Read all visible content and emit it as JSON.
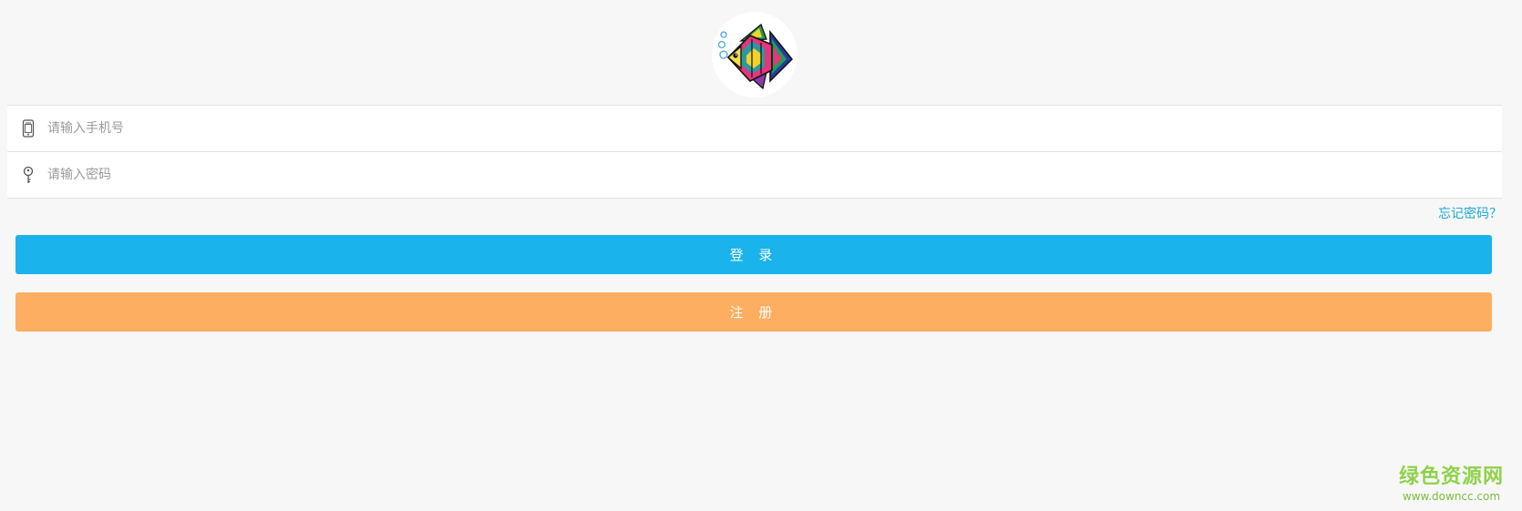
{
  "login_form": {
    "phone_placeholder": "请输入手机号",
    "password_placeholder": "请输入密码",
    "forgot_password": "忘记密码？",
    "login_button": "登 录",
    "register_button": "注 册"
  },
  "icons": {
    "avatar": "fish-illustration",
    "phone": "mobile-phone-icon",
    "password": "key-icon"
  },
  "colors": {
    "background": "#f7f7f7",
    "login_button": "#1ab3ec",
    "register_button": "#fdae60",
    "link": "#1ca8d8",
    "watermark": "#8fd24a"
  },
  "watermark": {
    "title": "绿色资源网",
    "url": "www.downcc.com"
  }
}
